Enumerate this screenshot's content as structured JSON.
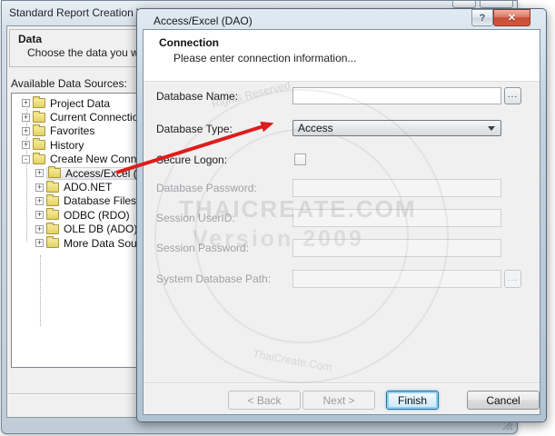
{
  "wizard": {
    "title": "Standard Report Creation Wizard",
    "help_glyph": "?",
    "close_glyph": "✕",
    "section": {
      "title": "Data",
      "description": "Choose the data you want to"
    },
    "sources_label": "Available Data Sources:",
    "tree": [
      {
        "label": "Project Data",
        "glyph": "+",
        "level": 0
      },
      {
        "label": "Current Connections",
        "glyph": "+",
        "level": 0
      },
      {
        "label": "Favorites",
        "glyph": "+",
        "level": 0
      },
      {
        "label": "History",
        "glyph": "+",
        "level": 0
      },
      {
        "label": "Create New Connection",
        "glyph": "-",
        "level": 0
      },
      {
        "label": "Access/Excel (DAO)",
        "glyph": "+",
        "level": 1,
        "selected": true
      },
      {
        "label": "ADO.NET",
        "glyph": "+",
        "level": 1
      },
      {
        "label": "Database Files",
        "glyph": "+",
        "level": 1
      },
      {
        "label": "ODBC (RDO)",
        "glyph": "+",
        "level": 1
      },
      {
        "label": "OLE DB (ADO)",
        "glyph": "+",
        "level": 1
      },
      {
        "label": "More Data Sources",
        "glyph": "+",
        "level": 1
      }
    ]
  },
  "dialog": {
    "title": "Access/Excel (DAO)",
    "help_glyph": "?",
    "close_glyph": "✕",
    "header": {
      "title": "Connection",
      "subtitle": "Please enter connection information..."
    },
    "fields": {
      "database_name": {
        "label": "Database Name:",
        "value": "",
        "browse": "...",
        "enabled": true
      },
      "database_type": {
        "label": "Database Type:",
        "value": "Access",
        "enabled": true
      },
      "secure_logon": {
        "label": "Secure Logon:",
        "checked": false,
        "enabled": true
      },
      "database_password": {
        "label": "Database Password:",
        "value": "",
        "enabled": false
      },
      "session_userid": {
        "label": "Session UserID:",
        "value": "",
        "enabled": false
      },
      "session_password": {
        "label": "Session Password:",
        "value": "",
        "enabled": false
      },
      "system_database_path": {
        "label": "System Database Path:",
        "value": "",
        "browse": "...",
        "enabled": false
      }
    },
    "buttons": {
      "back": "< Back",
      "next": "Next >",
      "finish": "Finish",
      "cancel": "Cancel"
    }
  },
  "watermark": {
    "brand": "THAICREATE.COM",
    "version": "Version 2009",
    "fragment_top": "Rights Reserved",
    "fragment_bottom": "ThaiCreate.Com"
  },
  "colors": {
    "arrow_red": "#e01b1b",
    "close_button_red": "#cf4437",
    "default_button_blue": "#3c7fb1",
    "folder_yellow": "#efe076"
  }
}
